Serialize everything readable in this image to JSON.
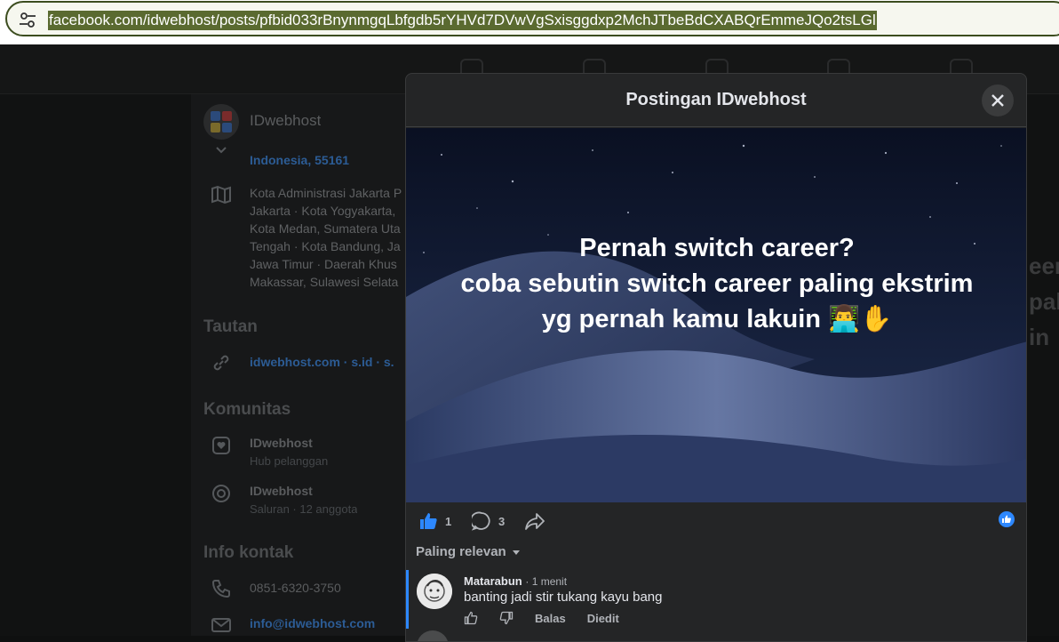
{
  "browser": {
    "url": "facebook.com/idwebhost/posts/pfbid033rBnynmgqLbfgdb5rYHVd7DVwVgSxisggdxp2MchJTbeBdCXABQrEmmeJQo2tsLGl"
  },
  "profile": {
    "name": "IDwebhost",
    "address_tail": "Indonesia, 55161",
    "locations": [
      "Kota Administrasi Jakarta P",
      "Jakarta · Kota Yogyakarta,",
      "Kota Medan, Sumatera Uta",
      "Tengah · Kota Bandung, Ja",
      "Jawa Timur · Daerah Khus",
      "Makassar, Sulawesi Selata"
    ],
    "links_heading": "Tautan",
    "links": "idwebhost.com · s.id · s.",
    "community_heading": "Komunitas",
    "communities": [
      {
        "name": "IDwebhost",
        "sub": "Hub pelanggan"
      },
      {
        "name": "IDwebhost",
        "sub": "Saluran · 12 anggota"
      }
    ],
    "contact_heading": "Info kontak",
    "phone": "0851-6320-3750",
    "email": "info@idwebhost.com"
  },
  "background_fragments": [
    "eer",
    "pal",
    "in"
  ],
  "modal": {
    "title": "Postingan IDwebhost",
    "post_lines": [
      "Pernah switch career?",
      "coba sebutin switch career paling ekstrim",
      "yg pernah kamu lakuin 👨‍💻✋"
    ],
    "like_count": "1",
    "comment_count": "3",
    "sort_label": "Paling relevan",
    "comment": {
      "author": "Matarabun",
      "time": "1 menit",
      "text": "banting jadi stir tukang kayu bang",
      "reply_label": "Balas",
      "edited_label": "Diedit"
    }
  },
  "colors": {
    "accent": "#2d88ff",
    "modal_bg": "#242526",
    "page_bg": "#0f1010"
  }
}
